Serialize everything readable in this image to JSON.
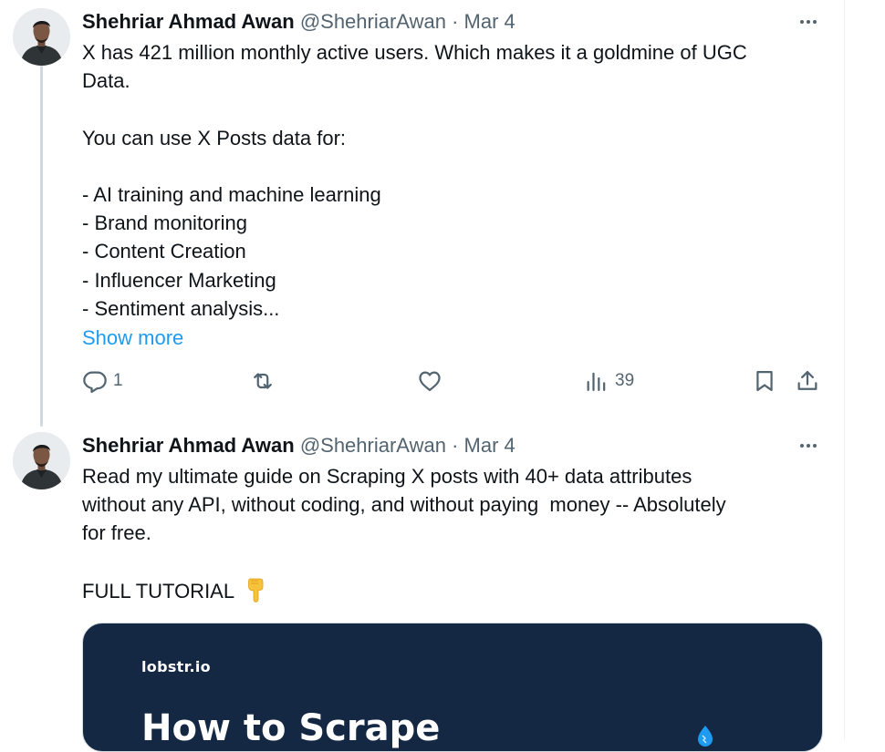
{
  "posts": [
    {
      "author_name": "Shehriar Ahmad Awan",
      "handle": "@ShehriarAwan",
      "separator": "·",
      "date": "Mar 4",
      "lines": [
        "X has 421 million monthly active users. Which makes it a goldmine of UGC",
        "Data.",
        "",
        "You can use X Posts data for:",
        "",
        "- AI training and machine learning",
        "- Brand monitoring",
        "- Content Creation",
        "- Influencer Marketing",
        "- Sentiment analysis..."
      ],
      "show_more_label": "Show more",
      "reply_count": "1",
      "view_count": "39"
    },
    {
      "author_name": "Shehriar Ahmad Awan",
      "handle": "@ShehriarAwan",
      "separator": "·",
      "date": "Mar 4",
      "lines": [
        "Read my ultimate guide on Scraping X posts with 40+ data attributes",
        "without any API, without coding, and without paying  money -- Absolutely",
        "for free.",
        "",
        "FULL TUTORIAL"
      ],
      "card": {
        "brand": "lobstr.io",
        "title": "How to Scrape"
      }
    }
  ],
  "icons": {
    "reply": "comment-icon",
    "repost": "repost-icon",
    "like": "heart-icon",
    "views": "bar-chart-icon",
    "bookmark": "bookmark-icon",
    "share": "share-icon",
    "emoji": "backhand-index-pointing-down"
  },
  "colors": {
    "link": "#1d9bf0",
    "secondary_text": "#536471",
    "card_background": "#142843"
  }
}
